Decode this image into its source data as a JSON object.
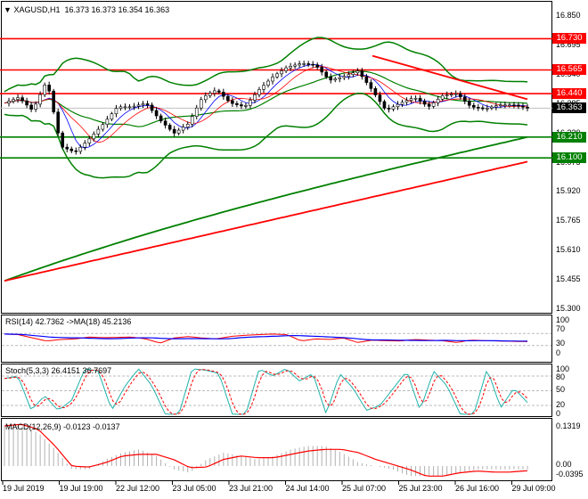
{
  "header": {
    "symbol": "XAGUSD,H1",
    "ohlc": "16.373 16.373 16.354 16.363"
  },
  "colors": {
    "bull": "#000000",
    "red": "#ff0000",
    "green": "#008000",
    "blue": "#0000ff",
    "teal": "#20b2aa",
    "bar_gray": "#b0b0b0"
  },
  "price_axis": [
    "16.850",
    "16.695",
    "16.540",
    "16.385",
    "16.230",
    "16.075",
    "15.920",
    "15.765",
    "15.610",
    "15.455",
    "15.300"
  ],
  "levels": [
    {
      "label": "16.730",
      "value": 16.73,
      "color": "#ff0000"
    },
    {
      "label": "16.565",
      "value": 16.565,
      "color": "#ff0000"
    },
    {
      "label": "16.440",
      "value": 16.44,
      "color": "#ff0000"
    },
    {
      "label": "16.210",
      "value": 16.21,
      "color": "#008000"
    },
    {
      "label": "16.100",
      "value": 16.1,
      "color": "#008000"
    }
  ],
  "current_price": {
    "label": "16.363",
    "value": 16.363
  },
  "chart_data": {
    "type": "line",
    "price_range": [
      15.3,
      16.85
    ],
    "closes": [
      16.39,
      16.42,
      16.35,
      16.51,
      16.16,
      16.13,
      16.2,
      16.28,
      16.37,
      16.37,
      16.39,
      16.3,
      16.23,
      16.28,
      16.42,
      16.46,
      16.39,
      16.37,
      16.46,
      16.53,
      16.58,
      16.6,
      16.59,
      16.51,
      16.53,
      16.56,
      16.46,
      16.35,
      16.39,
      16.42,
      16.37,
      16.43,
      16.44,
      16.37,
      16.36,
      16.38,
      16.38,
      16.363
    ],
    "ma200": [
      15.57,
      16.21
    ],
    "ma_red": [
      15.45,
      16.08
    ],
    "trendline": [
      16.64,
      16.41
    ],
    "rsi": {
      "label": "RSI(14) 42.7362  ->MA(18) 45.2136",
      "axis": [
        "100",
        "70",
        "30",
        "0"
      ],
      "values": [
        68,
        66,
        55,
        45,
        50,
        52,
        58,
        56,
        57,
        58,
        52,
        38,
        55,
        60,
        55,
        52,
        60,
        64,
        66,
        68,
        66,
        45,
        52,
        50,
        55,
        40,
        48,
        46,
        45,
        50,
        48,
        46,
        40,
        48,
        46,
        45,
        44,
        43
      ]
    },
    "stoch": {
      "label": "Stoch(5,3,3) 26.4151 36.7697",
      "axis": [
        "100",
        "80",
        "50",
        "20",
        "0"
      ],
      "values": [
        75,
        80,
        10,
        40,
        10,
        30,
        95,
        90,
        10,
        60,
        95,
        60,
        2,
        2,
        95,
        92,
        85,
        2,
        2,
        95,
        80,
        95,
        70,
        85,
        2,
        85,
        55,
        10,
        20,
        55,
        90,
        10,
        90,
        60,
        2,
        2,
        95,
        15,
        55,
        26
      ]
    },
    "macd": {
      "label": "MACD(12,26,9) -0.0123 -0.0137",
      "axis": [
        "0.1319",
        "0.00",
        "-0.0395"
      ],
      "hist": [
        0.12,
        0.12,
        0.1,
        0.05,
        -0.01,
        -0.01,
        0.02,
        0.04,
        0.05,
        0.03,
        -0.01,
        -0.02,
        0.02,
        0.04,
        0.03,
        0.02,
        0.03,
        0.05,
        0.06,
        0.06,
        0.04,
        0.01,
        0.0,
        -0.01,
        -0.03,
        -0.03,
        -0.03,
        -0.02,
        -0.01,
        -0.01,
        -0.01,
        -0.01
      ],
      "signal": [
        0.12,
        0.125,
        0.11,
        0.06,
        0.0,
        -0.003,
        0.01,
        0.03,
        0.035,
        0.035,
        0.02,
        -0.005,
        -0.003,
        0.02,
        0.03,
        0.025,
        0.025,
        0.035,
        0.045,
        0.05,
        0.05,
        0.04,
        0.02,
        0.005,
        -0.01,
        -0.03,
        -0.03,
        -0.02,
        -0.015,
        -0.018,
        -0.018,
        -0.014
      ]
    }
  },
  "x_axis": [
    "19 Jul 2019",
    "19 Jul 19:00",
    "22 Jul 12:00",
    "23 Jul 05:00",
    "23 Jul 21:00",
    "24 Jul 14:00",
    "25 Jul 07:00",
    "25 Jul 23:00",
    "26 Jul 16:00",
    "29 Jul 09:00"
  ]
}
